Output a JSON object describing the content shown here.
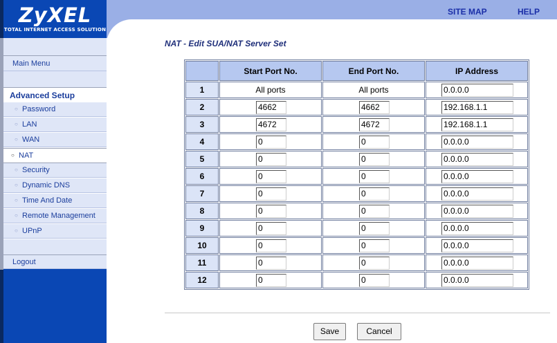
{
  "header": {
    "logo": "ZyXEL",
    "tagline": "Total Internet Access Solution",
    "site_map": "SITE MAP",
    "help": "HELP"
  },
  "sidebar": {
    "main_menu": "Main Menu",
    "advanced_heading": "Advanced Setup",
    "items_before": [
      {
        "label": "Password"
      },
      {
        "label": "LAN"
      },
      {
        "label": "WAN"
      }
    ],
    "active": "NAT",
    "items_after": [
      {
        "label": "Security"
      },
      {
        "label": "Dynamic DNS"
      },
      {
        "label": "Time And Date"
      },
      {
        "label": "Remote Management"
      },
      {
        "label": "UPnP"
      }
    ],
    "logout": "Logout"
  },
  "main": {
    "title": "NAT - Edit SUA/NAT Server Set",
    "columns": [
      "",
      "Start Port No.",
      "End Port No.",
      "IP Address"
    ],
    "rows": [
      {
        "num": "1",
        "start": "All ports",
        "end": "All ports",
        "ip": "0.0.0.0",
        "fixed": true
      },
      {
        "num": "2",
        "start": "4662",
        "end": "4662",
        "ip": "192.168.1.1"
      },
      {
        "num": "3",
        "start": "4672",
        "end": "4672",
        "ip": "192.168.1.1"
      },
      {
        "num": "4",
        "start": "0",
        "end": "0",
        "ip": "0.0.0.0"
      },
      {
        "num": "5",
        "start": "0",
        "end": "0",
        "ip": "0.0.0.0"
      },
      {
        "num": "6",
        "start": "0",
        "end": "0",
        "ip": "0.0.0.0"
      },
      {
        "num": "7",
        "start": "0",
        "end": "0",
        "ip": "0.0.0.0"
      },
      {
        "num": "8",
        "start": "0",
        "end": "0",
        "ip": "0.0.0.0"
      },
      {
        "num": "9",
        "start": "0",
        "end": "0",
        "ip": "0.0.0.0"
      },
      {
        "num": "10",
        "start": "0",
        "end": "0",
        "ip": "0.0.0.0"
      },
      {
        "num": "11",
        "start": "0",
        "end": "0",
        "ip": "0.0.0.0"
      },
      {
        "num": "12",
        "start": "0",
        "end": "0",
        "ip": "0.0.0.0"
      }
    ],
    "save": "Save",
    "cancel": "Cancel"
  },
  "colors": {
    "header_band": "#9aafe6",
    "logo_blue": "#0a47b4",
    "link_blue": "#1b2fa8",
    "table_header": "#b6c8f0",
    "row_number_bg": "#dbe4f7"
  }
}
